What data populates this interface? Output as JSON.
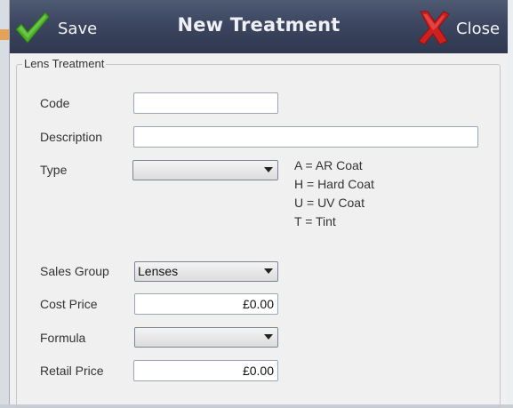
{
  "window": {
    "title": "New Treatment",
    "save_label": "Save",
    "close_label": "Close"
  },
  "group": {
    "legend": "Lens Treatment"
  },
  "fields": {
    "code": {
      "label": "Code",
      "value": ""
    },
    "description": {
      "label": "Description",
      "value": ""
    },
    "type": {
      "label": "Type",
      "selected": ""
    },
    "sales_group": {
      "label": "Sales Group",
      "selected": "Lenses"
    },
    "cost_price": {
      "label": "Cost Price",
      "value": "£0.00"
    },
    "formula": {
      "label": "Formula",
      "selected": ""
    },
    "retail_price": {
      "label": "Retail Price",
      "value": "£0.00"
    }
  },
  "type_legend": [
    "A = AR Coat",
    "H = Hard Coat",
    "U = UV Coat",
    "T = Tint"
  ],
  "colors": {
    "titlebar": "#3c4660",
    "save_check": "#4caf2a",
    "close_x": "#d01f1f"
  },
  "icons": {
    "save": "check-icon",
    "close": "x-icon"
  }
}
